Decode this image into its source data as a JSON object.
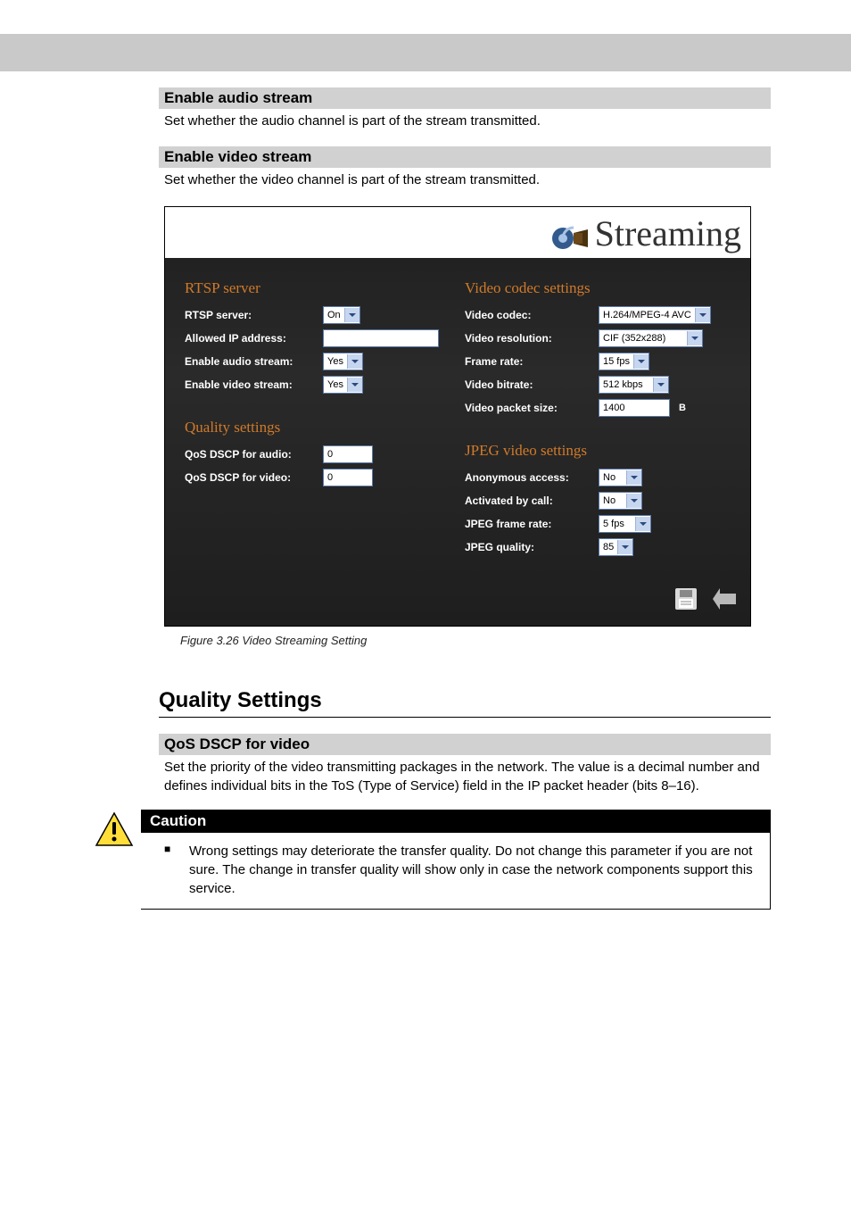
{
  "sections": {
    "enable_audio": {
      "title": "Enable audio stream",
      "text": "Set whether the audio channel is part of the stream transmitted."
    },
    "enable_video": {
      "title": "Enable video stream",
      "text": "Set whether the video channel is part of the stream transmitted."
    },
    "qos_video": {
      "title": "QoS DSCP for video",
      "text": "Set the priority of the video transmitting packages in the network. The value is a decimal number and defines individual bits in the ToS (Type of Service) field in the IP packet header (bits 8–16)."
    }
  },
  "heading_quality": "Quality Settings",
  "figure_caption": "Figure 3.26   Video Streaming Setting",
  "fig_title": "Streaming",
  "panel": {
    "rtsp": {
      "heading": "RTSP server",
      "rows": {
        "server": {
          "label": "RTSP server:",
          "value": "On"
        },
        "allowed_ip": {
          "label": "Allowed IP address:",
          "value": ""
        },
        "enable_audio": {
          "label": "Enable audio stream:",
          "value": "Yes"
        },
        "enable_video": {
          "label": "Enable video stream:",
          "value": "Yes"
        }
      }
    },
    "quality": {
      "heading": "Quality settings",
      "rows": {
        "dscp_audio": {
          "label": "QoS DSCP for audio:",
          "value": "0"
        },
        "dscp_video": {
          "label": "QoS DSCP for video:",
          "value": "0"
        }
      }
    },
    "codec": {
      "heading": "Video codec settings",
      "rows": {
        "codec": {
          "label": "Video codec:",
          "value": "H.264/MPEG-4 AVC"
        },
        "resolution": {
          "label": "Video resolution:",
          "value": "CIF (352x288)"
        },
        "frame_rate": {
          "label": "Frame rate:",
          "value": "15 fps"
        },
        "bitrate": {
          "label": "Video bitrate:",
          "value": "512 kbps"
        },
        "packet": {
          "label": "Video packet size:",
          "value": "1400",
          "unit": "B"
        }
      }
    },
    "jpeg": {
      "heading": "JPEG video settings",
      "rows": {
        "anon": {
          "label": "Anonymous access:",
          "value": "No"
        },
        "by_call": {
          "label": "Activated by call:",
          "value": "No"
        },
        "jfps": {
          "label": "JPEG frame rate:",
          "value": "5 fps"
        },
        "jquality": {
          "label": "JPEG quality:",
          "value": "85"
        }
      }
    }
  },
  "caution": {
    "heading": "Caution",
    "text": "Wrong settings may deteriorate the transfer quality. Do not change this parameter if you are not sure. The change in transfer quality will show only in case the network components support this service."
  }
}
